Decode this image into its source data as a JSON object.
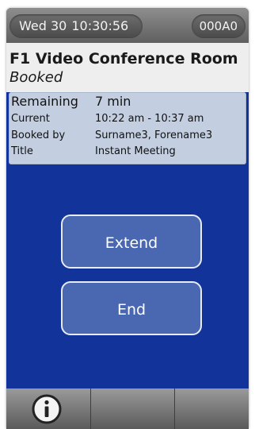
{
  "status": {
    "day": "Wed 30",
    "time": "10:30:56",
    "device_id": "000A0"
  },
  "room": {
    "name": "F1 Video Conference Room",
    "state": "Booked"
  },
  "booking": {
    "remaining_label": "Remaining",
    "remaining_value": "7 min",
    "current_label": "Current",
    "current_value": "10:22 am - 10:37 am",
    "booked_by_label": "Booked by",
    "booked_by_value": "Surname3, Forename3",
    "title_label": "Title",
    "title_value": "Instant Meeting"
  },
  "actions": {
    "extend_label": "Extend",
    "end_label": "End"
  },
  "toolbar": {
    "info_icon": "info-icon"
  },
  "colors": {
    "main_bg": "#12349a",
    "info_bg": "#c3cfe0",
    "button_bg": "#4a67b1"
  }
}
